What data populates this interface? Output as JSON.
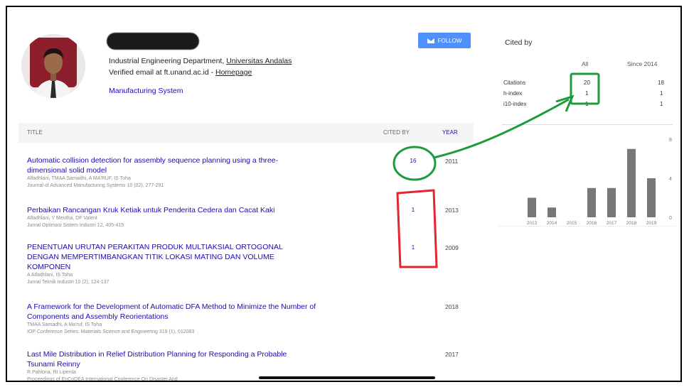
{
  "profile": {
    "affiliation_prefix": "Industrial Engineering Department, ",
    "affiliation_link": "Universitas Andalas",
    "verified_email": "Verified email at ft.unand.ac.id - ",
    "homepage": "Homepage",
    "interest": "Manufacturing System",
    "follow_label": "FOLLOW"
  },
  "table": {
    "headers": {
      "title": "TITLE",
      "cited_by": "CITED BY",
      "year": "YEAR"
    },
    "articles": [
      {
        "title_line1": "Automatic collision detection for assembly sequence planning using a three-",
        "title_line2": "dimensional solid model",
        "title_line3": "",
        "authors": "Alfadhlani, TMAA Samadhi, A MA'RUF, IS Toha",
        "venue": "Journal of Advanced Manufacturing Systems 10 (02), 277-291",
        "cited_by": "16",
        "year": "2011"
      },
      {
        "title_line1": "Perbaikan Rancangan Kruk Ketiak untuk Penderita Cedera dan Cacat Kaki",
        "title_line2": "",
        "title_line3": "",
        "authors": "Alfadhlani, Y Meutha, DF Valent",
        "venue": "Jurnal Optimasi Sistem Industri 12, 405-415",
        "cited_by": "1",
        "year": "2013"
      },
      {
        "title_line1": "PENENTUAN URUTAN PERAKITAN PRODUK MULTIAKSIAL ORTOGONAL",
        "title_line2": "DENGAN MEMPERTIMBANGKAN TITIK LOKASI MATING DAN VOLUME",
        "title_line3": "KOMPONEN",
        "authors": "A Alfadhlani, IS Toha",
        "venue": "Jurnal Teknik Industri 10 (2), 124-137",
        "cited_by": "1",
        "year": "2009"
      },
      {
        "title_line1": "A Framework for the Development of Automatic DFA Method to Minimize the Number of",
        "title_line2": "Components and Assembly Reorientations",
        "title_line3": "",
        "authors": "TMAA Samadhi, A Ma'ruf, IS Toha",
        "venue": "IOP Conference Series: Materials Science and Engineering 319 (1), 012083",
        "cited_by": "",
        "year": "2018"
      },
      {
        "title_line1": "Last Mile Distribution in Relief Distribution Planning for Responding a Probable",
        "title_line2": "Tsunami Reinny",
        "title_line3": "",
        "authors": "R Pahlona, RI Liperda",
        "venue": "Proceedings of EnCoDEA International Conference On Disaster And",
        "cited_by": "",
        "year": "2017"
      }
    ]
  },
  "cited_by_panel": {
    "title": "Cited by",
    "col_all": "All",
    "col_since": "Since 2014",
    "rows": [
      {
        "label": "Citations",
        "all": "20",
        "since": "18"
      },
      {
        "label": "h-index",
        "all": "1",
        "since": "1"
      },
      {
        "label": "i10-index",
        "all": "1",
        "since": "1"
      }
    ]
  },
  "chart_data": {
    "type": "bar",
    "categories": [
      "2013",
      "2014",
      "2015",
      "2016",
      "2017",
      "2018",
      "2019"
    ],
    "values": [
      2,
      1,
      0,
      3,
      3,
      7,
      4
    ],
    "ylim": [
      0,
      8
    ],
    "y_ticks": [
      "0",
      "4",
      "8"
    ],
    "color": "#777777"
  },
  "annotations": {
    "green": "#1e9b3a",
    "red": "#e3262f"
  }
}
